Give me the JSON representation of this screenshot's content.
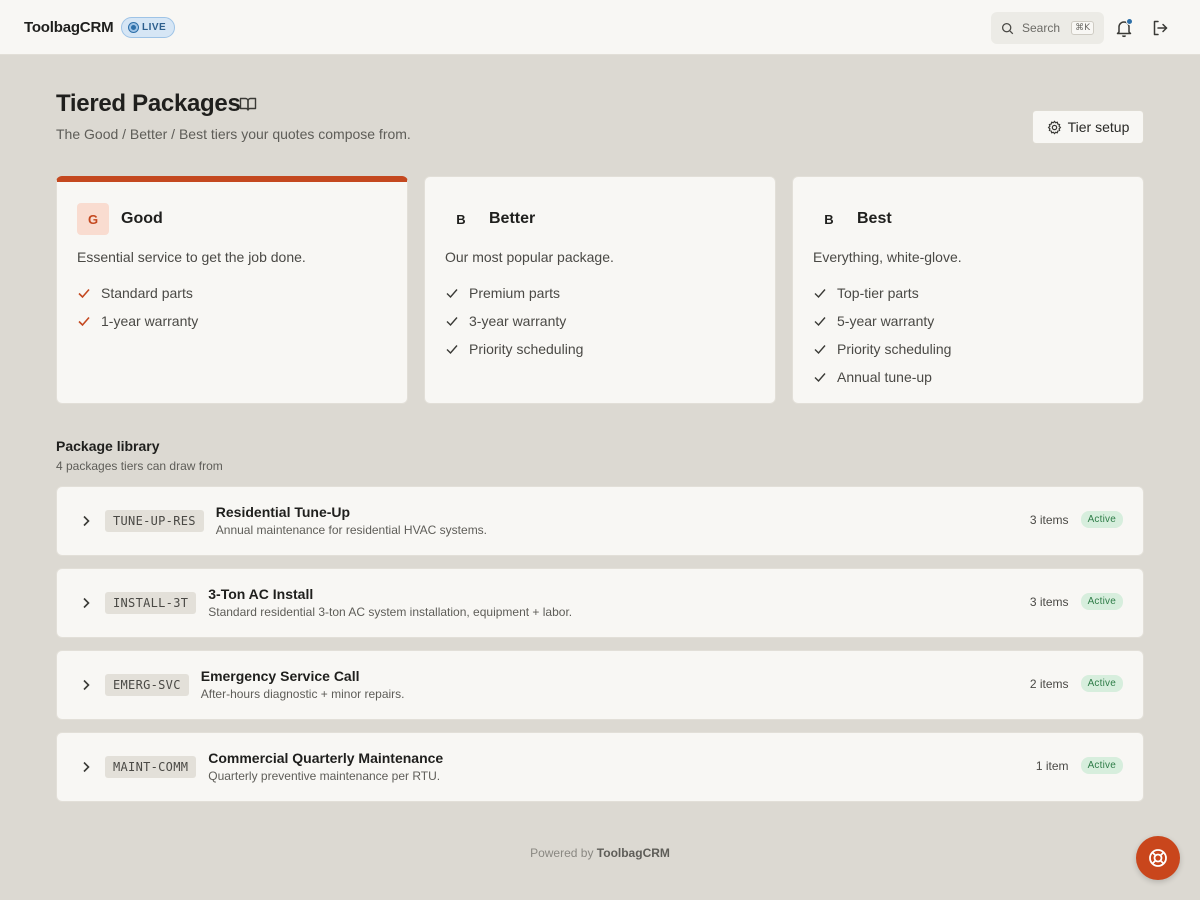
{
  "app": {
    "brand": "ToolbagCRM",
    "live_label": "LIVE",
    "accent": "#c4481f",
    "live_color": "#2d6fa8"
  },
  "header": {
    "search_placeholder": "Search",
    "search_shortcut": "⌘K",
    "icons": [
      "search-icon",
      "bell-icon",
      "logout-icon"
    ]
  },
  "page": {
    "title": "Tiered Packages",
    "subtitle": "The Good / Better / Best tiers your quotes compose from.",
    "tier_setup_label": "Tier setup"
  },
  "tiers": [
    {
      "letter": "G",
      "name": "Good",
      "description": "Essential service to get the job done.",
      "features": [
        "Standard parts",
        "1-year warranty"
      ]
    },
    {
      "letter": "B",
      "name": "Better",
      "description": "Our most popular package.",
      "features": [
        "Premium parts",
        "3-year warranty",
        "Priority scheduling"
      ]
    },
    {
      "letter": "B",
      "name": "Best",
      "description": "Everything, white-glove.",
      "features": [
        "Top-tier parts",
        "5-year warranty",
        "Priority scheduling",
        "Annual tune-up"
      ]
    }
  ],
  "library": {
    "title": "Package library",
    "subtitle": "4 packages tiers can draw from",
    "packages": [
      {
        "code": "TUNE-UP-RES",
        "name": "Residential Tune-Up",
        "description": "Annual maintenance for residential HVAC systems.",
        "count": "3 items",
        "status": "Active"
      },
      {
        "code": "INSTALL-3T",
        "name": "3-Ton AC Install",
        "description": "Standard residential 3-ton AC system installation, equipment + labor.",
        "count": "3 items",
        "status": "Active"
      },
      {
        "code": "EMERG-SVC",
        "name": "Emergency Service Call",
        "description": "After-hours diagnostic + minor repairs.",
        "count": "2 items",
        "status": "Active"
      },
      {
        "code": "MAINT-COMM",
        "name": "Commercial Quarterly Maintenance",
        "description": "Quarterly preventive maintenance per RTU.",
        "count": "1 item",
        "status": "Active"
      }
    ]
  },
  "footer": {
    "prefix": "Powered by",
    "brand": "ToolbagCRM"
  }
}
